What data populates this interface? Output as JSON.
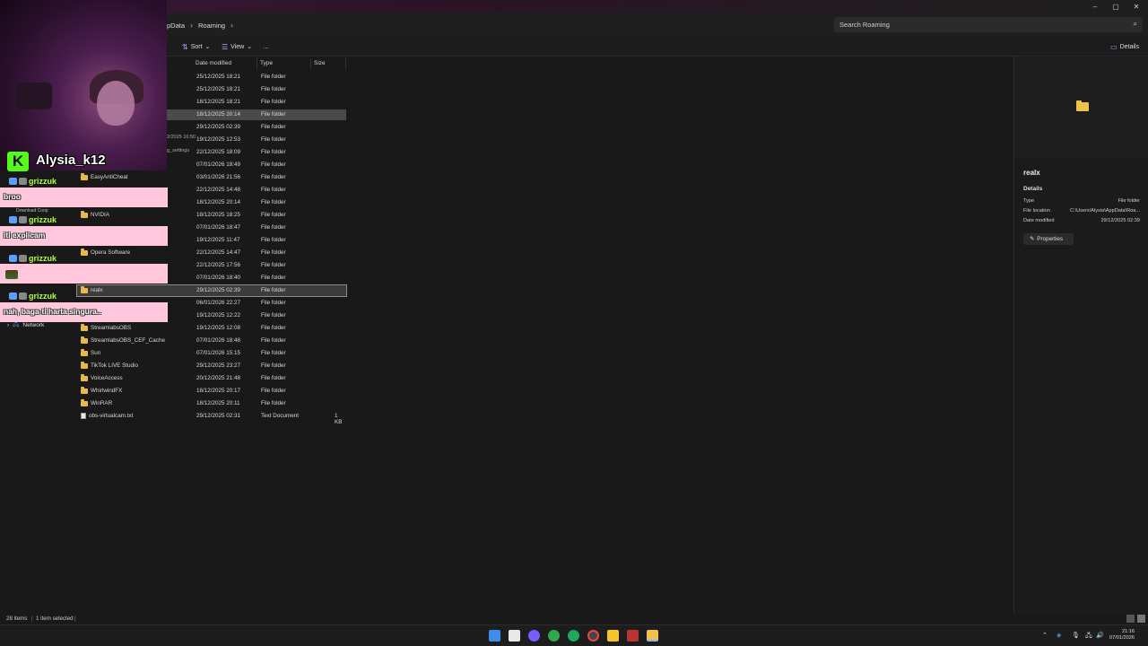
{
  "window": {
    "breadcrumb": [
      "pData",
      "Roaming"
    ],
    "search_placeholder": "Search Roaming",
    "controls": [
      "–",
      "▢",
      "✕"
    ]
  },
  "toolbar": {
    "sort_label": "Sort",
    "view_label": "View",
    "more_label": "…",
    "details_label": "Details"
  },
  "columns": {
    "date": "Date modified",
    "type": "Type",
    "size": "Size"
  },
  "sidebar": {
    "network_label": "Network",
    "partial_left": [
      "2/2025 16:50",
      "g_settings",
      "Download Coop"
    ]
  },
  "files": [
    {
      "name": "",
      "date": "25/12/2025 18:21",
      "type": "File folder",
      "size": "",
      "icon": "folder"
    },
    {
      "name": "",
      "date": "25/12/2025 18:21",
      "type": "File folder",
      "size": "",
      "icon": "folder"
    },
    {
      "name": "",
      "date": "18/12/2025 18:21",
      "type": "File folder",
      "size": "",
      "icon": "folder"
    },
    {
      "name": "",
      "date": "18/12/2025 20:14",
      "type": "File folder",
      "size": "",
      "icon": "folder",
      "state": "hover"
    },
    {
      "name": "",
      "date": "29/12/2025 02:39",
      "type": "File folder",
      "size": "",
      "icon": "folder"
    },
    {
      "name": "",
      "date": "19/12/2025 12:53",
      "type": "File folder",
      "size": "",
      "icon": "folder"
    },
    {
      "name": "",
      "date": "22/12/2025 18:09",
      "type": "File folder",
      "size": "",
      "icon": "folder"
    },
    {
      "name": "",
      "date": "07/01/2026 18:49",
      "type": "File folder",
      "size": "",
      "icon": "folder"
    },
    {
      "name": "EasyAntiCheat",
      "date": "03/01/2026 21:56",
      "type": "File folder",
      "size": "",
      "icon": "folder"
    },
    {
      "name": "",
      "date": "22/12/2025 14:48",
      "type": "File folder",
      "size": "",
      "icon": "folder"
    },
    {
      "name": "",
      "date": "18/12/2025 20:14",
      "type": "File folder",
      "size": "",
      "icon": "folder"
    },
    {
      "name": "NVIDIA",
      "date": "18/12/2025 18:25",
      "type": "File folder",
      "size": "",
      "icon": "folder"
    },
    {
      "name": "",
      "date": "07/01/2026 18:47",
      "type": "File folder",
      "size": "",
      "icon": "folder"
    },
    {
      "name": "",
      "date": "19/12/2025 11:47",
      "type": "File folder",
      "size": "",
      "icon": "folder"
    },
    {
      "name": "Opera Software",
      "date": "22/12/2025 14:47",
      "type": "File folder",
      "size": "",
      "icon": "folder"
    },
    {
      "name": "",
      "date": "22/12/2025 17:56",
      "type": "File folder",
      "size": "",
      "icon": "folder"
    },
    {
      "name": "",
      "date": "07/01/2026 18:40",
      "type": "File folder",
      "size": "",
      "icon": "folder"
    },
    {
      "name": "realx",
      "date": "29/12/2025 02:39",
      "type": "File folder",
      "size": "",
      "icon": "folder",
      "state": "selected"
    },
    {
      "name": "",
      "date": "06/01/2026 22:27",
      "type": "File folder",
      "size": "",
      "icon": "folder"
    },
    {
      "name": "",
      "date": "19/12/2025 12:22",
      "type": "File folder",
      "size": "",
      "icon": "folder"
    },
    {
      "name": "StreamlabsOBS",
      "date": "19/12/2025 12:08",
      "type": "File folder",
      "size": "",
      "icon": "folder"
    },
    {
      "name": "StreamlabsOBS_CEF_Cache",
      "date": "07/01/2026 18:48",
      "type": "File folder",
      "size": "",
      "icon": "folder"
    },
    {
      "name": "Sun",
      "date": "07/01/2026 15:15",
      "type": "File folder",
      "size": "",
      "icon": "folder"
    },
    {
      "name": "TikTok LIVE Studio",
      "date": "29/12/2025 23:27",
      "type": "File folder",
      "size": "",
      "icon": "folder"
    },
    {
      "name": "VoiceAccess",
      "date": "20/12/2025 21:48",
      "type": "File folder",
      "size": "",
      "icon": "folder"
    },
    {
      "name": "WhirlwindFX",
      "date": "18/12/2025 20:17",
      "type": "File folder",
      "size": "",
      "icon": "folder"
    },
    {
      "name": "WinRAR",
      "date": "18/12/2025 20:11",
      "type": "File folder",
      "size": "",
      "icon": "folder"
    },
    {
      "name": "obs-virtualcam.txt",
      "date": "29/12/2025 02:31",
      "type": "Text Document",
      "size": "1 KB",
      "icon": "text-file"
    }
  ],
  "details": {
    "name": "realx",
    "section": "Details",
    "type_label": "Type",
    "type_value": "File folder",
    "location_label": "File location",
    "location_value": "C:\\Users\\Alysia\\AppData\\Roa...",
    "modified_label": "Date modified",
    "modified_value": "29/12/2025 02:39",
    "properties_label": "Properties"
  },
  "status": {
    "items": "28 items",
    "selected": "1 item selected"
  },
  "taskbar": {
    "time": "21:16",
    "date": "07/01/2026"
  },
  "overlay": {
    "streamer": "Alysia_k12",
    "kick_letter": "K",
    "chat": [
      {
        "user": "grizzuk",
        "message": "broo"
      },
      {
        "user": "grizzuk",
        "message": "iti explicam"
      },
      {
        "user": "grizzuk",
        "message": ""
      },
      {
        "user": "grizzuk",
        "message": "nah, baga-ti harta singura.."
      }
    ]
  }
}
